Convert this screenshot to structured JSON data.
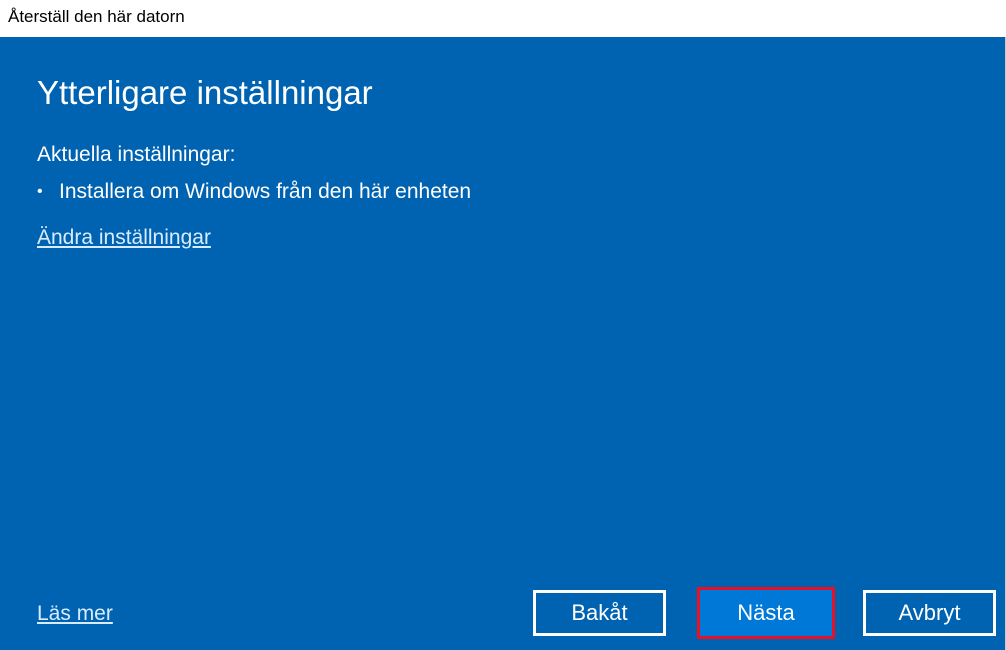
{
  "window": {
    "title": "Återställ den här datorn"
  },
  "main": {
    "heading": "Ytterligare inställningar",
    "current_settings_label": "Aktuella inställningar:",
    "settings": [
      "Installera om Windows från den här enheten"
    ],
    "change_settings_link": "Ändra inställningar"
  },
  "footer": {
    "learn_more_link": "Läs mer",
    "back_label": "Bakåt",
    "next_label": "Nästa",
    "cancel_label": "Avbryt"
  },
  "colors": {
    "background": "#0063b1",
    "button_primary": "#0078d7",
    "highlight_border": "#e81123",
    "link": "#d9ecff"
  }
}
